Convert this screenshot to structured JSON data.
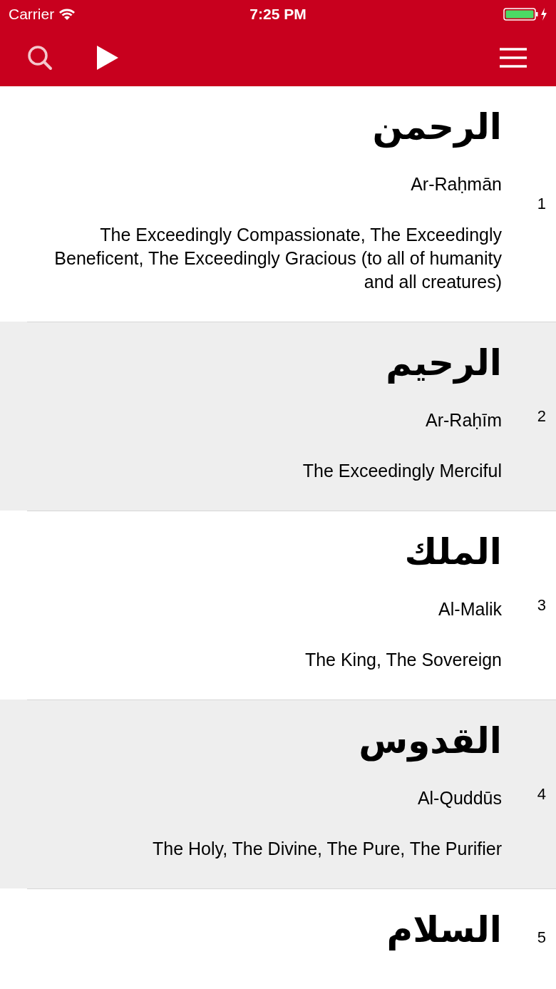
{
  "status_bar": {
    "carrier": "Carrier",
    "time": "7:25 PM"
  },
  "names": [
    {
      "number": "1",
      "arabic": "الرحمن",
      "transliteration": "Ar-Raḥmān",
      "meaning": "The Exceedingly Compassionate, The Exceedingly Beneficent, The Exceedingly Gracious (to all of humanity and all creatures)"
    },
    {
      "number": "2",
      "arabic": "الرحيم",
      "transliteration": "Ar-Raḥīm",
      "meaning": "The Exceedingly Merciful"
    },
    {
      "number": "3",
      "arabic": "الملك",
      "transliteration": "Al-Malik",
      "meaning": "The King, The Sovereign"
    },
    {
      "number": "4",
      "arabic": "القدوس",
      "transliteration": "Al-Quddūs",
      "meaning": "The Holy, The Divine, The Pure, The Purifier"
    },
    {
      "number": "5",
      "arabic": "السلام"
    }
  ]
}
